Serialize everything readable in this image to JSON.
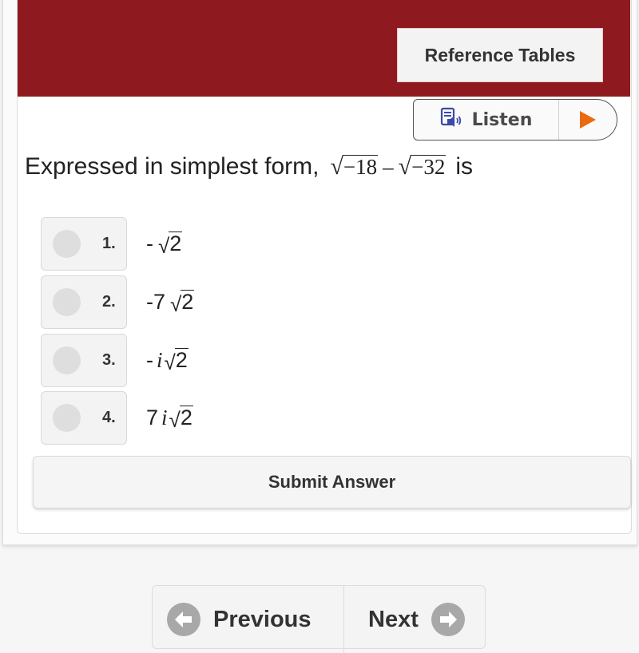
{
  "header": {
    "reference_tables_label": "Reference Tables",
    "color": "#8e1a20"
  },
  "listen": {
    "label": "Listen",
    "icon": "speaker-document-icon",
    "play_icon": "play-icon",
    "play_color": "#ea6a0e"
  },
  "question": {
    "prefix": "Expressed in simplest form,",
    "term1_radicand": "−18",
    "operator": "–",
    "term2_radicand": "−32",
    "suffix": "is"
  },
  "options": [
    {
      "number": "1.",
      "coefficient": "-",
      "imaginary": "",
      "radicand": "2",
      "selected": false
    },
    {
      "number": "2.",
      "coefficient": "-7",
      "imaginary": "",
      "radicand": "2",
      "selected": false
    },
    {
      "number": "3.",
      "coefficient": "-",
      "imaginary": "i",
      "radicand": "2",
      "selected": false
    },
    {
      "number": "4.",
      "coefficient": "7",
      "imaginary": "i",
      "radicand": "2",
      "selected": false
    }
  ],
  "submit_label": "Submit Answer",
  "nav": {
    "previous_label": "Previous",
    "next_label": "Next"
  }
}
